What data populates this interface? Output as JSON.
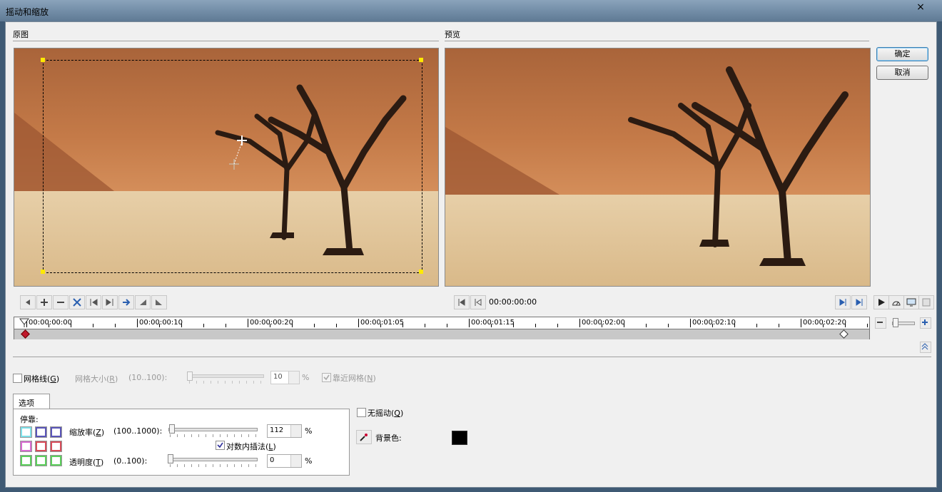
{
  "window": {
    "title": "摇动和缩放",
    "close_glyph": "×"
  },
  "panels": {
    "original_label": "原图",
    "preview_label": "预览"
  },
  "dialog_buttons": {
    "ok": "确定",
    "cancel": "取消"
  },
  "preview_time": "00:00:00:00",
  "timeline": {
    "ticks": [
      "00:00:00:00",
      "00:00:00:10",
      "00:00:00:20",
      "00:00:01:05",
      "00:00:01:15",
      "00:00:02:00",
      "00:00:02:10",
      "00:00:02:20"
    ]
  },
  "grid": {
    "gridlines_label": "网格线",
    "gridlines_key": "G",
    "gridlines_checked": false,
    "grid_size_label": "网格大小",
    "grid_size_key": "R",
    "grid_size_range": "(10..100):",
    "grid_size_value": "10",
    "grid_size_unit": "%",
    "snap_label": "靠近网格",
    "snap_key": "N",
    "snap_checked": true
  },
  "options": {
    "tab_label": "选项",
    "dock_label": "停靠:",
    "zoom_label": "缩放率",
    "zoom_key": "Z",
    "zoom_range": "(100..1000):",
    "zoom_value": "112",
    "zoom_unit": "%",
    "zoom_slider_fraction": 0.013,
    "log_interp_label": "对数内插法",
    "log_interp_key": "L",
    "log_interp_checked": true,
    "opacity_label": "透明度",
    "opacity_key": "T",
    "opacity_range": "(0..100):",
    "opacity_value": "0",
    "opacity_unit": "%",
    "opacity_slider_fraction": 0.0,
    "dock_colors": [
      "#7de0e8",
      "#5a55b8",
      "#5a55b8",
      "#d86ad0",
      "#d84c5a",
      "#d84c5a",
      "#5ccf5c",
      "#5ccf5c",
      "#5ccf5c"
    ]
  },
  "no_shake": {
    "label": "无摇动",
    "key": "Q",
    "checked": false
  },
  "background": {
    "label": "背景色:",
    "color": "#000000"
  },
  "icons": [
    "eyedropper-icon",
    "play-icon",
    "zoom-in-icon",
    "zoom-out-icon"
  ]
}
